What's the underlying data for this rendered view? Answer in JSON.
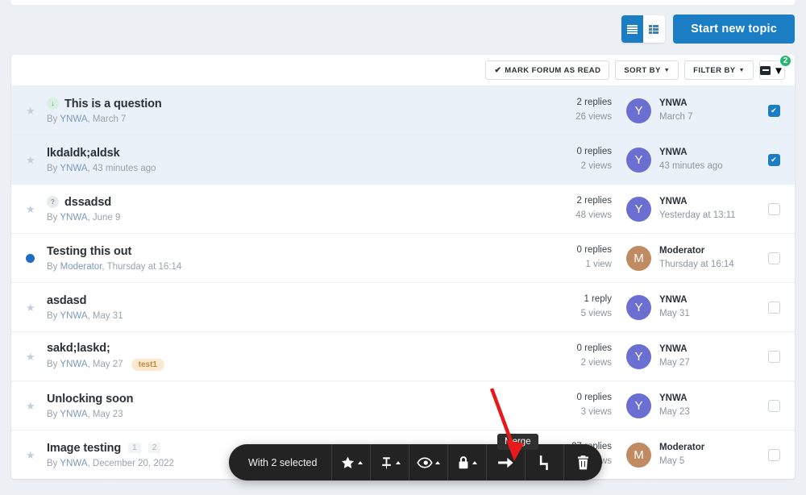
{
  "top_controls": {
    "view_list_label": "list-view",
    "view_grid_label": "grid-view",
    "start_topic_label": "Start new topic"
  },
  "filterbar": {
    "mark_read_label": "MARK FORUM AS READ",
    "mark_read_check": "✔",
    "sort_by_label": "SORT BY",
    "filter_by_label": "FILTER BY",
    "selected_count_badge": "2"
  },
  "topics": [
    {
      "title": "This is a question",
      "badge": "↓",
      "badge_type": "answered",
      "byline_prefix": "By ",
      "author_link": "YNWA",
      "byline_rest": ", March 7",
      "tag": "",
      "pages": [],
      "replies": "2 replies",
      "views": "26 views",
      "avatar_letter": "Y",
      "avatar_color": "#6b6fd1",
      "last_author": "YNWA",
      "last_date": "March 7",
      "checked": true,
      "unread": false
    },
    {
      "title": "lkdaldk;aldsk",
      "badge": "",
      "badge_type": "",
      "byline_prefix": "By ",
      "author_link": "YNWA",
      "byline_rest": ", 43 minutes ago",
      "tag": "",
      "pages": [],
      "replies": "0 replies",
      "views": "2 views",
      "avatar_letter": "Y",
      "avatar_color": "#6b6fd1",
      "last_author": "YNWA",
      "last_date": "43 minutes ago",
      "checked": true,
      "unread": false
    },
    {
      "title": "dssadsd",
      "badge": "?",
      "badge_type": "unanswered",
      "byline_prefix": "By ",
      "author_link": "YNWA",
      "byline_rest": ", June 9",
      "tag": "",
      "pages": [],
      "replies": "2 replies",
      "views": "48 views",
      "avatar_letter": "Y",
      "avatar_color": "#6b6fd1",
      "last_author": "YNWA",
      "last_date": "Yesterday at 13:11",
      "checked": false,
      "unread": false
    },
    {
      "title": "Testing this out",
      "badge": "",
      "badge_type": "",
      "byline_prefix": "By ",
      "author_link": "Moderator",
      "byline_rest": ", Thursday at 16:14",
      "tag": "",
      "pages": [],
      "replies": "0 replies",
      "views": "1 view",
      "avatar_letter": "M",
      "avatar_color": "#c08b62",
      "last_author": "Moderator",
      "last_date": "Thursday at 16:14",
      "checked": false,
      "unread": true
    },
    {
      "title": "asdasd",
      "badge": "",
      "badge_type": "",
      "byline_prefix": "By ",
      "author_link": "YNWA",
      "byline_rest": ", May 31",
      "tag": "",
      "pages": [],
      "replies": "1 reply",
      "views": "5 views",
      "avatar_letter": "Y",
      "avatar_color": "#6b6fd1",
      "last_author": "YNWA",
      "last_date": "May 31",
      "checked": false,
      "unread": false
    },
    {
      "title": "sakd;laskd;",
      "badge": "",
      "badge_type": "",
      "byline_prefix": "By ",
      "author_link": "YNWA",
      "byline_rest": ", May 27",
      "tag": "test1",
      "pages": [],
      "replies": "0 replies",
      "views": "2 views",
      "avatar_letter": "Y",
      "avatar_color": "#6b6fd1",
      "last_author": "YNWA",
      "last_date": "May 27",
      "checked": false,
      "unread": false
    },
    {
      "title": "Unlocking soon",
      "badge": "",
      "badge_type": "",
      "byline_prefix": "By ",
      "author_link": "YNWA",
      "byline_rest": ", May 23",
      "tag": "",
      "pages": [],
      "replies": "0 replies",
      "views": "3 views",
      "avatar_letter": "Y",
      "avatar_color": "#6b6fd1",
      "last_author": "YNWA",
      "last_date": "May 23",
      "checked": false,
      "unread": false
    },
    {
      "title": "Image testing",
      "badge": "",
      "badge_type": "",
      "byline_prefix": "By ",
      "author_link": "YNWA",
      "byline_rest": ", December 20, 2022",
      "tag": "",
      "pages": [
        "1",
        "2"
      ],
      "replies": "27 replies",
      "views": "k views",
      "avatar_letter": "M",
      "avatar_color": "#c08b62",
      "last_author": "Moderator",
      "last_date": "May 5",
      "checked": false,
      "unread": false
    }
  ],
  "action_bar": {
    "selected_label": "With 2 selected",
    "buttons": [
      {
        "name": "star-icon",
        "has_caret": true
      },
      {
        "name": "pin-icon",
        "has_caret": true
      },
      {
        "name": "eye-icon",
        "has_caret": true
      },
      {
        "name": "lock-icon",
        "has_caret": true
      },
      {
        "name": "move-arrow-icon",
        "has_caret": false
      },
      {
        "name": "merge-icon",
        "has_caret": false
      },
      {
        "name": "trash-icon",
        "has_caret": false
      }
    ],
    "tooltip": "Merge"
  }
}
